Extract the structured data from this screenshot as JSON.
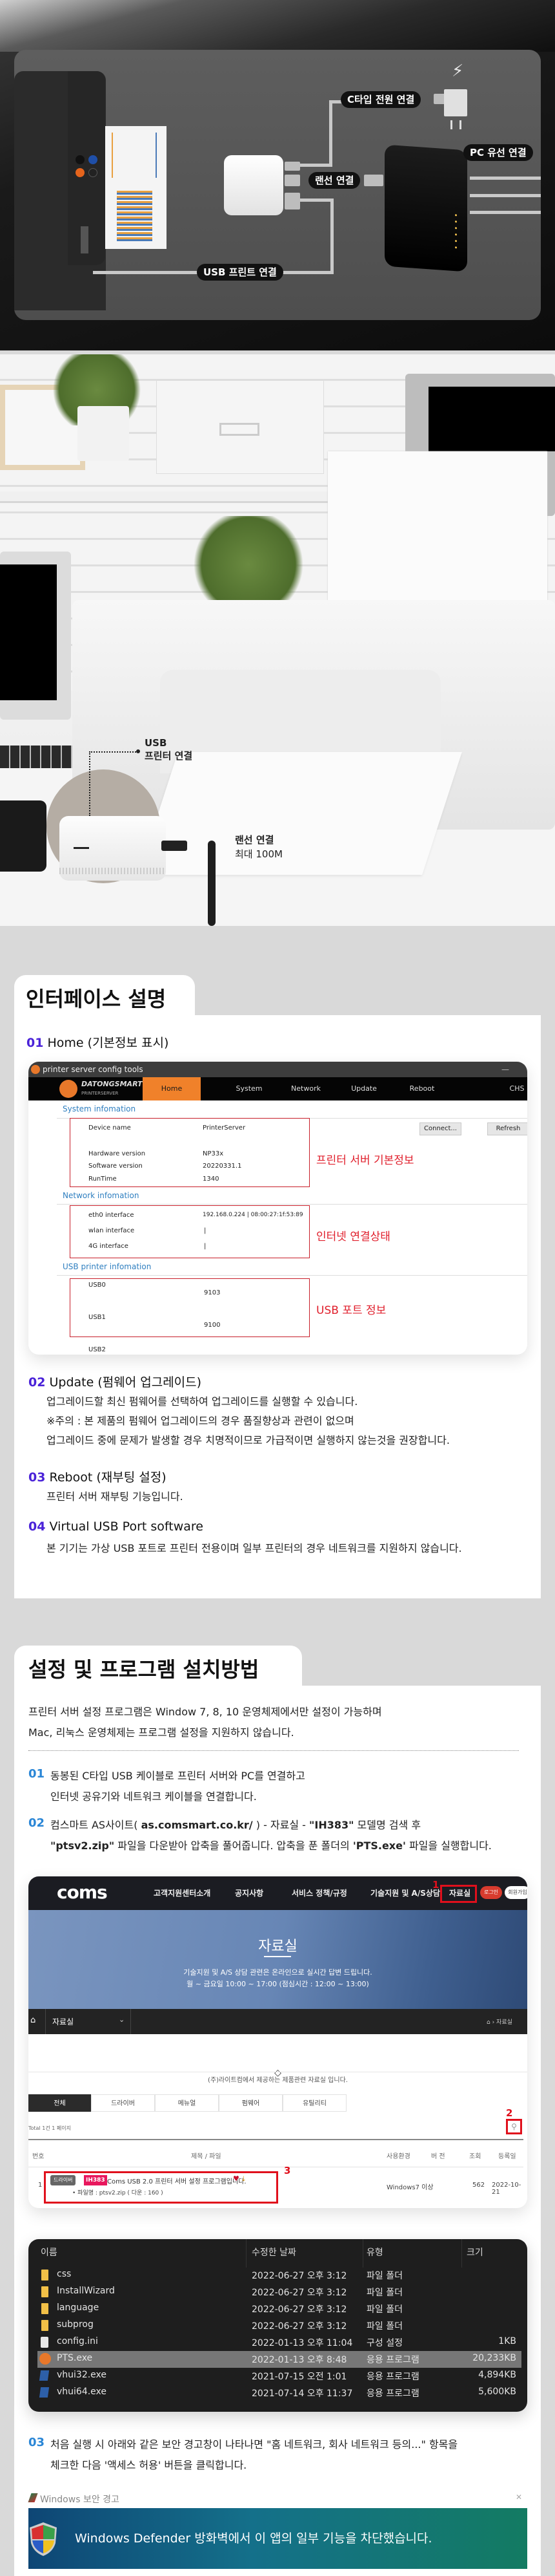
{
  "diagram": {
    "labels": {
      "power": "C타입 전원 연결",
      "pc": "PC 유선 연결",
      "lan": "랜선 연결",
      "usb_print": "USB 프린트 연결"
    },
    "icons": [
      "bolt-icon",
      "usb-icon",
      "power-plug-icon",
      "lan-port-icon"
    ]
  },
  "photo": {
    "usb_label_line1": "USB",
    "usb_label_line2": "프린터 연결",
    "lan_label_line1": "랜선 연결",
    "lan_label_line2": "최대 100M"
  },
  "interface": {
    "title": "인터페이스 설명",
    "items": [
      {
        "num": "01",
        "title": "Home (기본정보 표시)"
      },
      {
        "num": "02",
        "title": "Update (펌웨어 업그레이드)",
        "lines": [
          "업그레이드할 최신 펌웨어를 선택하여 업그레이드를 실행할 수 있습니다.",
          "※주의 :  본 제품의 펌웨어 업그레이드의 경우 품질향상과 관련이 없으며",
          "업그레이드 중에 문제가 발생할 경우 치명적이므로 가급적이면 실행하지 않는것을 권장합니다."
        ]
      },
      {
        "num": "03",
        "title": "Reboot (재부팅 설정)",
        "lines": [
          "프린터 서버 재부팅 기능입니다."
        ]
      },
      {
        "num": "04",
        "title": "Virtual USB Port software",
        "lines": [
          "본 기기는 가상 USB 포트로 프린터 전용이며 일부 프린터의 경우 네트워크를 지원하지 않습니다."
        ]
      }
    ],
    "config_tool": {
      "window_title": "printer server config tools",
      "minimize": "—",
      "brand": "DATONGSMART",
      "brand_sub": "PRINTERSERVER",
      "nav": [
        "Home",
        "System",
        "Network",
        "Update",
        "Reboot",
        "CHS"
      ],
      "active_nav": "Home",
      "system_section": "System infomation",
      "system_rows": [
        {
          "key": "Device name",
          "value": "PrinterServer"
        },
        {
          "key": "Hardware version",
          "value": "NP33x"
        },
        {
          "key": "Software version",
          "value": "20220331.1"
        },
        {
          "key": "RunTime",
          "value": "1340"
        }
      ],
      "connect_btn": "Connect...",
      "refresh_btn": "Refresh",
      "network_section": "Network infomation",
      "network_rows": [
        {
          "key": "eth0 interface",
          "value": "192.168.0.224 | 08:00:27:1f:53:89"
        },
        {
          "key": "wlan interface",
          "value": "|"
        },
        {
          "key": "4G interface",
          "value": "|"
        }
      ],
      "usb_section": "USB printer infomation",
      "usb_rows": [
        {
          "key": "USB0",
          "value": "9103"
        },
        {
          "key": "USB1",
          "value": "9100"
        },
        {
          "key": "USB2",
          "value": ""
        }
      ],
      "annotations": {
        "system": "프린터 서버 기본정보",
        "network": "인터넷 연결상태",
        "usb": "USB 포트 정보"
      }
    }
  },
  "setup": {
    "title": "설정 및 프로그램 설치방법",
    "intro": [
      "프린터 서버 설정 프로그램은 Window 7, 8, 10 운영체제에서만 설정이 가능하며",
      "Mac, 리눅스 운영체제는 프로그램 설정을 지원하지 않습니다."
    ],
    "steps": [
      {
        "num": "01",
        "lines": [
          "동봉된 C타입 USB 케이블로 프린터 서버와 PC를 연결하고",
          "인터넷 공유기와 네트워크 케이블을 연결합니다."
        ]
      },
      {
        "num": "02",
        "line1_pre": "컴스마트 AS사이트( ",
        "line1_url": "as.comsmart.co.kr/",
        "line1_mid": " ) - 자료실 - ",
        "line1_model": "\"IH383\"",
        "line1_post": " 모델명 검색 후",
        "line2_zip": "\"ptsv2.zip\"",
        "line2_mid": " 파일을 다운받아 압축을 풀어줍니다. 압축을 푼 폴더의 ",
        "line2_exe": "'PTS.exe'",
        "line2_post": " 파일을 실행합니다."
      },
      {
        "num": "03",
        "lines": [
          "처음 실행 시 아래와 같은 보안 경고창이 나타나면 \"홈 네트워크, 회사 네트워크 등의...\" 항목을",
          "체크한 다음 '액세스 허용' 버튼을 클릭합니다."
        ]
      }
    ],
    "coms_site": {
      "logo": "coms",
      "nav": [
        "고객지원센터소개",
        "공지사항",
        "서비스 정책/규정",
        "기술지원 및 A/S상담",
        "자료실"
      ],
      "login": "로그인",
      "signup": "회원가입",
      "marker1": "1",
      "marker2": "2",
      "marker3": "3",
      "banner_title": "자료실",
      "banner_line1": "기술지원 및 A/S 상담 관련은 온라인으로 실시간 답변 드립니다.",
      "banner_line2": "월 ~ 금요일 10:00 ~ 17:00 (점심시간 : 12:00 ~ 13:00)",
      "subnav_label": "자료실",
      "breadcrumb": "자료실",
      "intro": "(주)라이트컴에서 제공하는 제품관련 자료실 입니다.",
      "tabs": [
        "전체",
        "드라이버",
        "메뉴얼",
        "펌웨어",
        "유틸리티"
      ],
      "active_tab": "전체",
      "total": "Total 1건 1 페이지",
      "columns": [
        "번호",
        "제목 / 파일",
        "사용환경",
        "버 전",
        "조회",
        "등록일"
      ],
      "rows": [
        {
          "no": "1",
          "category": "드라이버",
          "model": "IH383",
          "title": "Coms USB 2.0 프린터 서버 설정 프로그램입니다.",
          "file": "• 파일명 : ptsv2.zip ( 다운 : 160 )",
          "env": "Windows7 이상",
          "version": "",
          "views": "562",
          "date": "2022-10-21"
        }
      ]
    },
    "explorer": {
      "columns": [
        "이름",
        "수정한 날짜",
        "유형",
        "크기"
      ],
      "rows": [
        {
          "icon": "folder",
          "name": "css",
          "date": "2022-06-27 오후 3:12",
          "type": "파일 폴더",
          "size": ""
        },
        {
          "icon": "folder",
          "name": "InstallWizard",
          "date": "2022-06-27 오후 3:12",
          "type": "파일 폴더",
          "size": ""
        },
        {
          "icon": "folder",
          "name": "language",
          "date": "2022-06-27 오후 3:12",
          "type": "파일 폴더",
          "size": ""
        },
        {
          "icon": "folder",
          "name": "subprog",
          "date": "2022-06-27 오후 3:12",
          "type": "파일 폴더",
          "size": ""
        },
        {
          "icon": "config",
          "name": "config.ini",
          "date": "2022-01-13 오후 11:04",
          "type": "구성 설정",
          "size": "1KB"
        },
        {
          "icon": "app-orange",
          "name": "PTS.exe",
          "date": "2022-01-13 오후 8:48",
          "type": "응용 프로그램",
          "size": "20,233KB",
          "selected": true
        },
        {
          "icon": "app-blue",
          "name": "vhui32.exe",
          "date": "2021-07-15 오전 1:01",
          "type": "응용 프로그램",
          "size": "4,894KB"
        },
        {
          "icon": "app-blue",
          "name": "vhui64.exe",
          "date": "2021-07-14 오후 11:37",
          "type": "응용 프로그램",
          "size": "5,600KB"
        }
      ]
    },
    "windows_alert": {
      "title": "Windows 보안 경고",
      "message": "Windows Defender 방화벽에서 이 앱의 일부 기능을 차단했습니다."
    }
  },
  "colors": {
    "accent_purple": "#4a22d8",
    "accent_blue": "#2a86d6",
    "annotation_red": "#e01e2b",
    "config_orange": "#f0812a",
    "coms_dark": "#1b1c22",
    "model_pink": "#e8175d"
  }
}
